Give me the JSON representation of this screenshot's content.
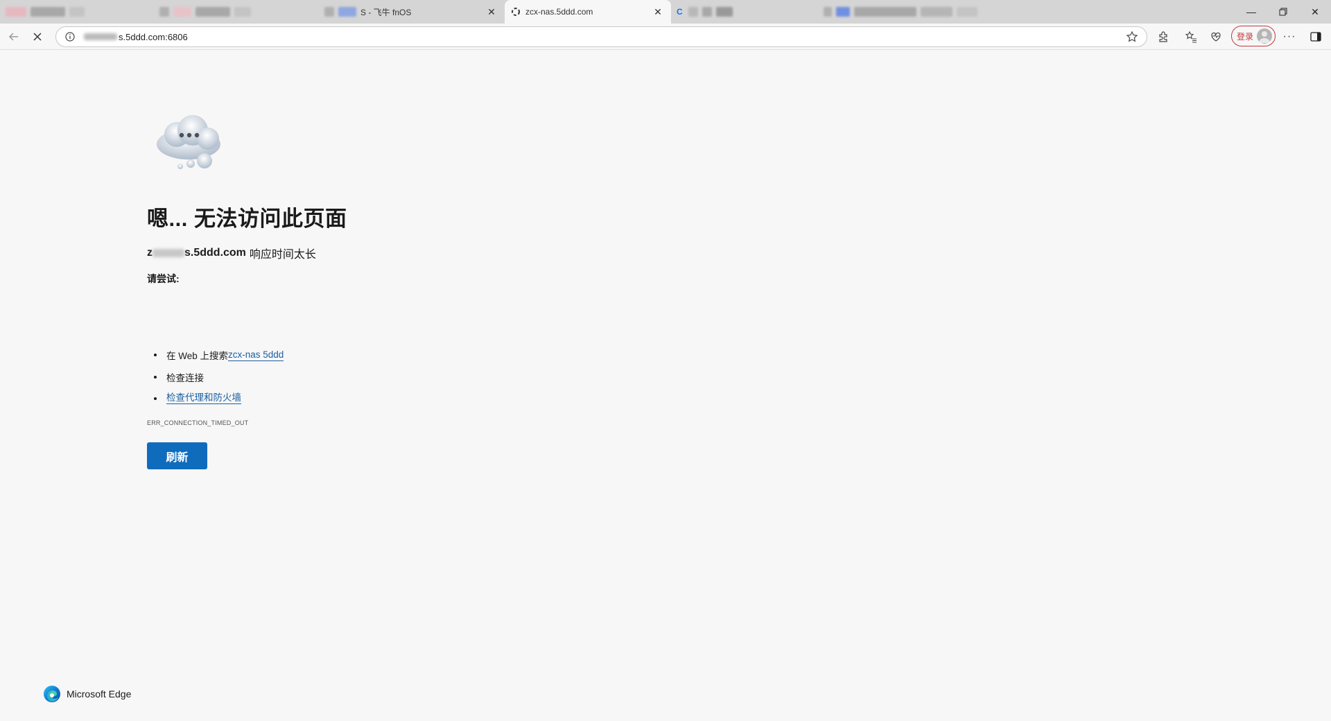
{
  "tabs": [
    {
      "title": "",
      "active": false
    },
    {
      "title": "",
      "active": false
    },
    {
      "title": "S - 飞牛 fnOS",
      "active": false
    },
    {
      "title": "zcx-nas.5ddd.com",
      "active": true
    },
    {
      "title": "",
      "active": false
    }
  ],
  "addressbar": {
    "url": "s.5ddd.com:6806"
  },
  "toolbar": {
    "login_label": "登录"
  },
  "error": {
    "title": "嗯... 无法访问此页面",
    "host": "s.5ddd.com",
    "host_prefix": "z",
    "message": "响应时间太长",
    "try_label": "请尝试:",
    "suggestions": [
      {
        "prefix": "在 Web 上搜索 ",
        "link": "zcx-nas 5ddd"
      },
      {
        "prefix": "检查连接",
        "link": ""
      },
      {
        "prefix": "",
        "link": "检查代理和防火墙"
      }
    ],
    "code": "ERR_CONNECTION_TIMED_OUT",
    "refresh_label": "刷新"
  },
  "footer": {
    "brand": "Microsoft Edge"
  },
  "colors": {
    "accent": "#0f6cbd",
    "link": "#1a5fa0",
    "login_border": "#c2383c"
  }
}
